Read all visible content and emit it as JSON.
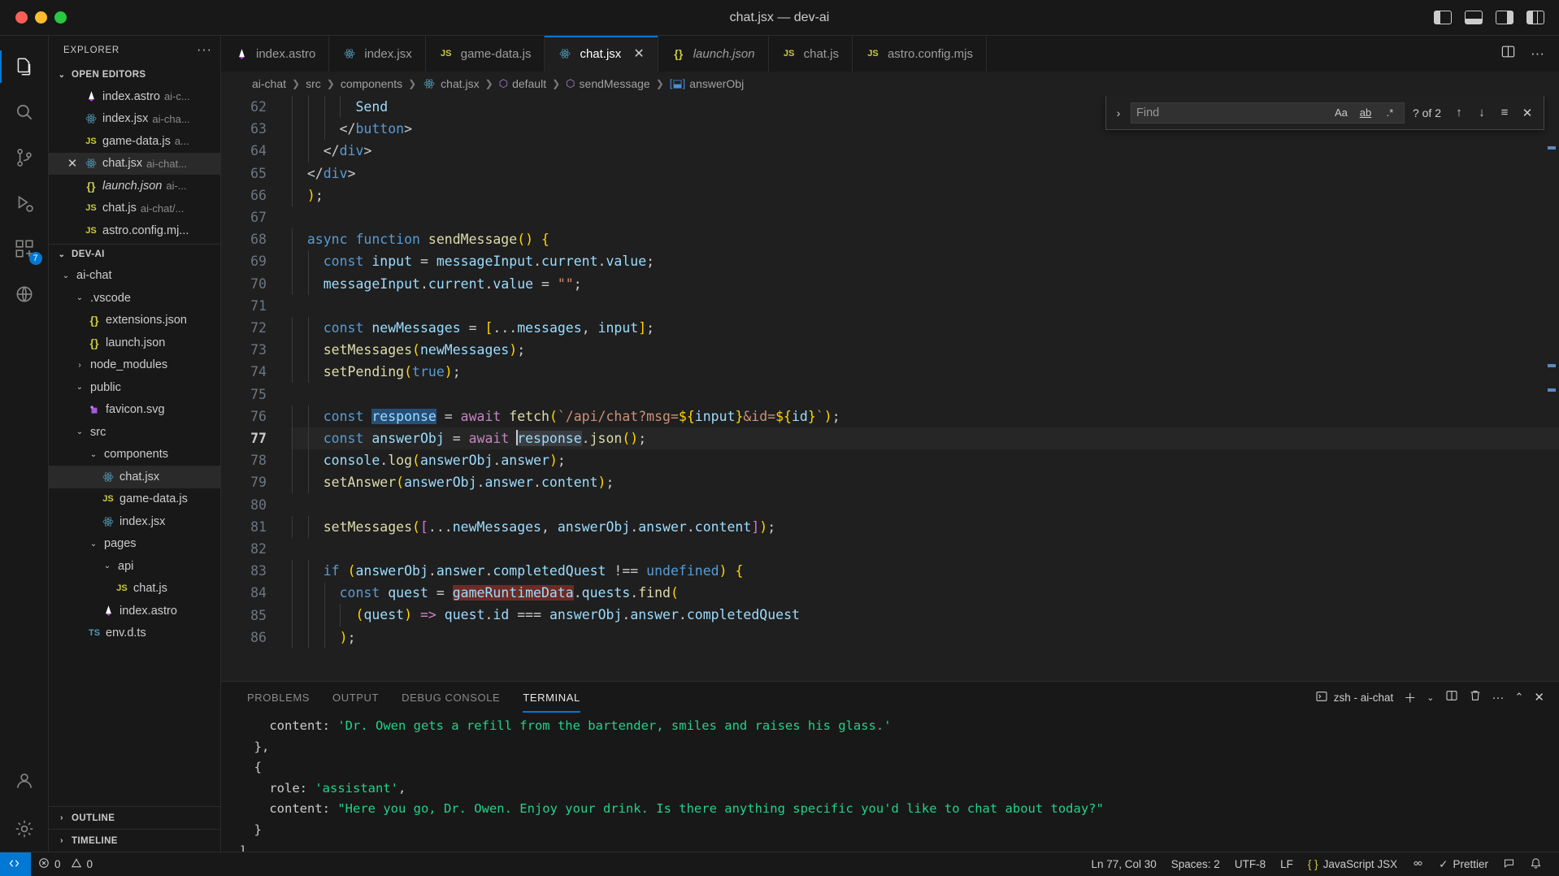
{
  "window": {
    "title": "chat.jsx — dev-ai",
    "traffic_lights": [
      "close",
      "minimize",
      "zoom"
    ],
    "layout_icons": [
      "toggle-primary-sidebar",
      "toggle-panel",
      "toggle-secondary-sidebar",
      "customize-layout"
    ]
  },
  "activitybar": {
    "items": [
      {
        "name": "explorer",
        "icon": "files-icon",
        "active": true,
        "badge": ""
      },
      {
        "name": "search",
        "icon": "search-icon",
        "active": false,
        "badge": ""
      },
      {
        "name": "source-control",
        "icon": "source-control-icon",
        "active": false,
        "badge": ""
      },
      {
        "name": "run-and-debug",
        "icon": "debug-icon",
        "active": false,
        "badge": ""
      },
      {
        "name": "extensions",
        "icon": "extensions-icon",
        "active": false,
        "badge": "7"
      },
      {
        "name": "remote-explorer",
        "icon": "remote-icon",
        "active": false,
        "badge": ""
      }
    ],
    "bottom": [
      {
        "name": "accounts",
        "icon": "account-icon"
      },
      {
        "name": "settings",
        "icon": "gear-icon"
      }
    ]
  },
  "sidebar": {
    "title": "EXPLORER",
    "more_actions": "···",
    "open_editors": {
      "label": "OPEN EDITORS",
      "items": [
        {
          "icon": "astro-icon",
          "name": "index.astro",
          "desc": "ai-c...",
          "active": false,
          "italic": false
        },
        {
          "icon": "react-icon",
          "name": "index.jsx",
          "desc": "ai-cha...",
          "active": false,
          "italic": false
        },
        {
          "icon": "js-icon",
          "name": "game-data.js",
          "desc": "a...",
          "active": false,
          "italic": false
        },
        {
          "icon": "react-icon",
          "name": "chat.jsx",
          "desc": "ai-chat...",
          "active": true,
          "italic": false
        },
        {
          "icon": "json-icon",
          "name": "launch.json",
          "desc": "ai-...",
          "active": false,
          "italic": true
        },
        {
          "icon": "js-icon",
          "name": "chat.js",
          "desc": "ai-chat/...",
          "active": false,
          "italic": false
        },
        {
          "icon": "js-icon",
          "name": "astro.config.mj...",
          "desc": "",
          "active": false,
          "italic": false
        }
      ]
    },
    "workspace": {
      "label": "DEV-AI",
      "items": [
        {
          "icon": "chevron-down-icon",
          "name": "ai-chat",
          "indent": 1,
          "type": "folder",
          "selected": false
        },
        {
          "icon": "chevron-down-icon",
          "name": ".vscode",
          "indent": 2,
          "type": "folder",
          "selected": false
        },
        {
          "icon": "json-icon",
          "name": "extensions.json",
          "indent": 3,
          "type": "file",
          "selected": false
        },
        {
          "icon": "json-icon",
          "name": "launch.json",
          "indent": 3,
          "type": "file",
          "selected": false
        },
        {
          "icon": "chevron-right-icon",
          "name": "node_modules",
          "indent": 2,
          "type": "folder",
          "selected": false
        },
        {
          "icon": "chevron-down-icon",
          "name": "public",
          "indent": 2,
          "type": "folder",
          "selected": false
        },
        {
          "icon": "svg-icon",
          "name": "favicon.svg",
          "indent": 3,
          "type": "file",
          "selected": false
        },
        {
          "icon": "chevron-down-icon",
          "name": "src",
          "indent": 2,
          "type": "folder",
          "selected": false
        },
        {
          "icon": "chevron-down-icon",
          "name": "components",
          "indent": 3,
          "type": "folder",
          "selected": false
        },
        {
          "icon": "react-icon",
          "name": "chat.jsx",
          "indent": 4,
          "type": "file",
          "selected": true
        },
        {
          "icon": "js-icon",
          "name": "game-data.js",
          "indent": 4,
          "type": "file",
          "selected": false
        },
        {
          "icon": "react-icon",
          "name": "index.jsx",
          "indent": 4,
          "type": "file",
          "selected": false
        },
        {
          "icon": "chevron-down-icon",
          "name": "pages",
          "indent": 3,
          "type": "folder",
          "selected": false
        },
        {
          "icon": "chevron-down-icon",
          "name": "api",
          "indent": 4,
          "type": "folder",
          "selected": false
        },
        {
          "icon": "js-icon",
          "name": "chat.js",
          "indent": 5,
          "type": "file",
          "selected": false
        },
        {
          "icon": "astro-icon",
          "name": "index.astro",
          "indent": 4,
          "type": "file",
          "selected": false
        },
        {
          "icon": "ts-icon",
          "name": "env.d.ts",
          "indent": 3,
          "type": "file",
          "selected": false
        }
      ]
    },
    "outline_label": "OUTLINE",
    "timeline_label": "TIMELINE"
  },
  "tabs": [
    {
      "label": "index.astro",
      "icon": "astro-icon",
      "active": false,
      "italic": false,
      "closable": false
    },
    {
      "label": "index.jsx",
      "icon": "react-icon",
      "active": false,
      "italic": false,
      "closable": false
    },
    {
      "label": "game-data.js",
      "icon": "js-icon",
      "active": false,
      "italic": false,
      "closable": false
    },
    {
      "label": "chat.jsx",
      "icon": "react-icon",
      "active": true,
      "italic": false,
      "closable": true
    },
    {
      "label": "launch.json",
      "icon": "json-icon",
      "active": false,
      "italic": true,
      "closable": false
    },
    {
      "label": "chat.js",
      "icon": "js-icon",
      "active": false,
      "italic": false,
      "closable": false
    },
    {
      "label": "astro.config.mjs",
      "icon": "js-icon",
      "active": false,
      "italic": false,
      "closable": false
    }
  ],
  "tabs_actions": {
    "split_editor": "split-editor-icon",
    "more": "···"
  },
  "breadcrumb": [
    {
      "label": "ai-chat",
      "icon": ""
    },
    {
      "label": "src",
      "icon": ""
    },
    {
      "label": "components",
      "icon": ""
    },
    {
      "label": "chat.jsx",
      "icon": "react-icon"
    },
    {
      "label": "default",
      "icon": "symbol-class-icon"
    },
    {
      "label": "sendMessage",
      "icon": "symbol-class-icon"
    },
    {
      "label": "answerObj",
      "icon": "symbol-variable-icon"
    }
  ],
  "find": {
    "placeholder": "Find",
    "value": "",
    "toggle_replace": "chevron-right-icon",
    "match_case": "Aa",
    "whole_word": "ab",
    "regex": ".*",
    "count": "? of 2",
    "prev": "arrow-up-icon",
    "next": "arrow-down-icon",
    "find_in_selection": "selection-icon",
    "close": "close-icon"
  },
  "editor": {
    "first_line": 62,
    "current_line": 77,
    "lines": [
      {
        "n": 62,
        "text": "        Send"
      },
      {
        "n": 63,
        "text": "      </button>"
      },
      {
        "n": 64,
        "text": "    </div>"
      },
      {
        "n": 65,
        "text": "  </div>"
      },
      {
        "n": 66,
        "text": "  );"
      },
      {
        "n": 67,
        "text": ""
      },
      {
        "n": 68,
        "text": "  async function sendMessage() {"
      },
      {
        "n": 69,
        "text": "    const input = messageInput.current.value;"
      },
      {
        "n": 70,
        "text": "    messageInput.current.value = \"\";"
      },
      {
        "n": 71,
        "text": ""
      },
      {
        "n": 72,
        "text": "    const newMessages = [...messages, input];"
      },
      {
        "n": 73,
        "text": "    setMessages(newMessages);"
      },
      {
        "n": 74,
        "text": "    setPending(true);"
      },
      {
        "n": 75,
        "text": ""
      },
      {
        "n": 76,
        "text": "    const response = await fetch(`/api/chat?msg=${input}&id=${id}`);"
      },
      {
        "n": 77,
        "text": "    const answerObj = await response.json();"
      },
      {
        "n": 78,
        "text": "    console.log(answerObj.answer);"
      },
      {
        "n": 79,
        "text": "    setAnswer(answerObj.answer.content);"
      },
      {
        "n": 80,
        "text": ""
      },
      {
        "n": 81,
        "text": "    setMessages([...newMessages, answerObj.answer.content]);"
      },
      {
        "n": 82,
        "text": ""
      },
      {
        "n": 83,
        "text": "    if (answerObj.answer.completedQuest !== undefined) {"
      },
      {
        "n": 84,
        "text": "      const quest = gameRuntimeData.quests.find("
      },
      {
        "n": 85,
        "text": "        (quest) => quest.id === answerObj.answer.completedQuest"
      },
      {
        "n": 86,
        "text": "      );"
      }
    ]
  },
  "panel": {
    "tabs": [
      {
        "label": "PROBLEMS",
        "active": false
      },
      {
        "label": "OUTPUT",
        "active": false
      },
      {
        "label": "DEBUG CONSOLE",
        "active": false
      },
      {
        "label": "TERMINAL",
        "active": true
      }
    ],
    "terminal_name": "zsh - ai-chat",
    "actions": {
      "new_terminal": "plus-icon",
      "terminal_dropdown": "chevron-down-icon",
      "split_terminal": "split-icon",
      "kill_terminal": "trash-icon",
      "more": "···",
      "maximize": "chevron-up-icon",
      "close": "close-icon"
    },
    "terminal_lines": [
      [
        {
          "t": "    content: ",
          "c": "plain"
        },
        {
          "t": "'Dr. Owen gets a refill from the bartender, smiles and raises his glass.'",
          "c": "green"
        }
      ],
      [
        {
          "t": "  },",
          "c": "plain"
        }
      ],
      [
        {
          "t": "  {",
          "c": "plain"
        }
      ],
      [
        {
          "t": "    role: ",
          "c": "plain"
        },
        {
          "t": "'assistant'",
          "c": "green"
        },
        {
          "t": ",",
          "c": "plain"
        }
      ],
      [
        {
          "t": "    content: ",
          "c": "plain"
        },
        {
          "t": "\"Here you go, Dr. Owen. Enjoy your drink. Is there anything specific you'd like to chat about today?\"",
          "c": "green"
        }
      ],
      [
        {
          "t": "  }",
          "c": "plain"
        }
      ],
      [
        {
          "t": "]",
          "c": "plain"
        }
      ]
    ]
  },
  "statusbar": {
    "remote_label": "",
    "errors": "0",
    "warnings": "0",
    "position": "Ln 77, Col 30",
    "indentation": "Spaces: 2",
    "encoding": "UTF-8",
    "eol": "LF",
    "language": "JavaScript JSX",
    "prettier": "Prettier",
    "icons": {
      "remote": "remote-icon",
      "error": "error-icon",
      "warning": "warning-icon",
      "language_icon": "json-brace-icon",
      "port": "port-icon",
      "prettier_check": "check-icon",
      "feedback": "feedback-icon",
      "bell": "bell-icon"
    }
  }
}
